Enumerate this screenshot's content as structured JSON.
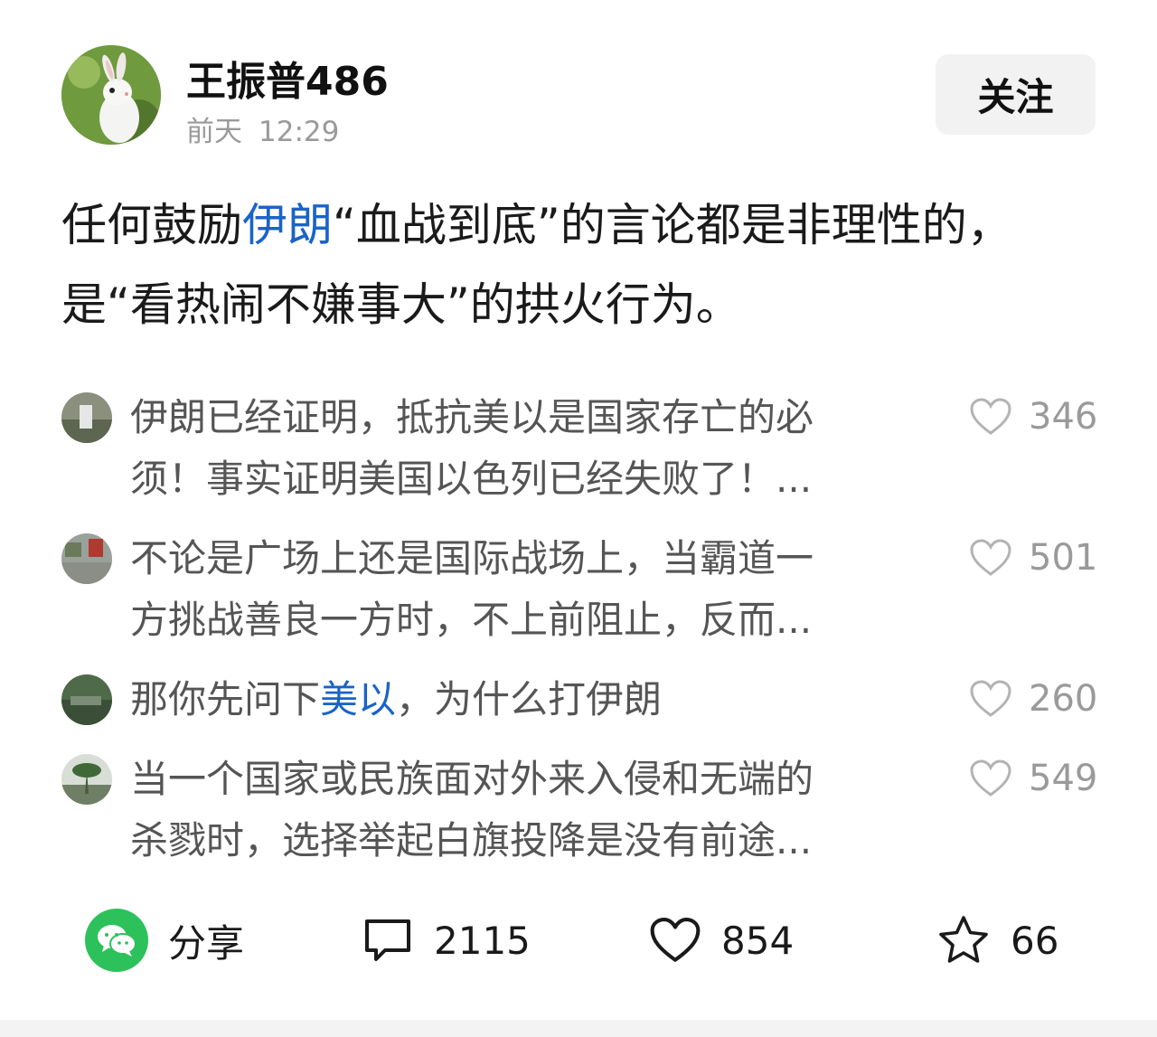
{
  "author": {
    "name": "王振普486",
    "time_day": "前天",
    "time_clock": "12:29",
    "follow_label": "关注"
  },
  "post": {
    "line1_before": "任何鼓励",
    "line1_link": "伊朗",
    "line1_after": "“血战到底”的言论都是非理性的，",
    "line2": "是“看热闹不嫌事大”的拱火行为。"
  },
  "comments": [
    {
      "line1": "伊朗已经证明，抵抗美以是国家存亡的必",
      "line2": "须！事实证明美国以色列已经失败了！...",
      "likes": "346"
    },
    {
      "line1": "不论是广场上还是国际战场上，当霸道一",
      "line2": "方挑战善良一方时，不上前阻止，反而...",
      "likes": "501"
    },
    {
      "text_before": "那你先问下",
      "text_link": "美以",
      "text_after": "，为什么打伊朗",
      "likes": "260"
    },
    {
      "line1": "当一个国家或民族面对外来入侵和无端的",
      "line2": "杀戮时，选择举起白旗投降是没有前途...",
      "likes": "549"
    }
  ],
  "actions": {
    "share_label": "分享",
    "comment_count": "2115",
    "like_count": "854",
    "favorite_count": "66"
  },
  "colors": {
    "link": "#1a63c9",
    "wechat_green": "#2dc15b",
    "muted": "#9a9a9a"
  },
  "icons": [
    "wechat-icon",
    "comment-icon",
    "heart-icon",
    "star-icon"
  ]
}
